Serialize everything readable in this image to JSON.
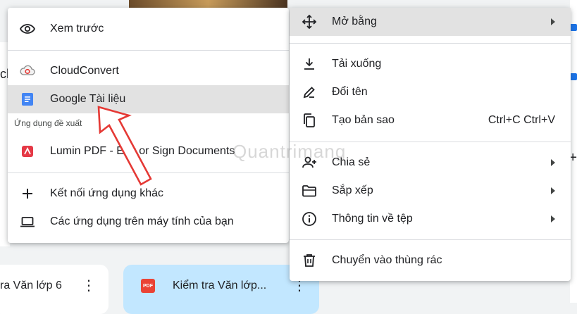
{
  "background": {
    "partial_doc_text": "ch",
    "files": [
      {
        "title": "ra Văn lớp 6"
      },
      {
        "title": "Kiểm tra Văn lớp...",
        "badge": "PDF"
      }
    ]
  },
  "open_with_menu": {
    "preview": {
      "label": "Xem trước",
      "icon": "eye-icon"
    },
    "apps": [
      {
        "label": "CloudConvert",
        "icon": "cloudconvert-icon"
      },
      {
        "label": "Google Tài liệu",
        "icon": "google-docs-icon",
        "highlighted": true
      }
    ],
    "suggested_label": "Ứng dụng đề xuất",
    "suggested_apps": [
      {
        "label": "Lumin PDF - Edit or Sign Documents",
        "icon": "lumin-pdf-icon"
      }
    ],
    "connect_more": {
      "label": "Kết nối ứng dụng khác",
      "icon": "plus-icon"
    },
    "computer_apps": {
      "label": "Các ứng dụng trên máy tính của bạn",
      "icon": "laptop-icon"
    }
  },
  "context_menu": {
    "items": [
      {
        "label": "Mở bằng",
        "icon": "open-with-icon",
        "submenu": true,
        "highlighted": true
      },
      {
        "label": "Tải xuống",
        "icon": "download-icon"
      },
      {
        "label": "Đổi tên",
        "icon": "rename-icon"
      },
      {
        "label": "Tạo bản sao",
        "icon": "copy-icon",
        "shortcut": "Ctrl+C Ctrl+V"
      },
      {
        "label": "Chia sẻ",
        "icon": "share-icon",
        "submenu": true
      },
      {
        "label": "Sắp xếp",
        "icon": "organize-icon",
        "submenu": true
      },
      {
        "label": "Thông tin về tệp",
        "icon": "info-icon",
        "submenu": true
      },
      {
        "label": "Chuyển vào thùng rác",
        "icon": "trash-icon"
      }
    ]
  },
  "watermark": "Quantrimang",
  "colors": {
    "highlight": "#e2e2e2",
    "selected_card": "#c2e7ff",
    "annotation_arrow": "#e53935",
    "docs_blue": "#4285f4",
    "lumin_red": "#e53946"
  }
}
